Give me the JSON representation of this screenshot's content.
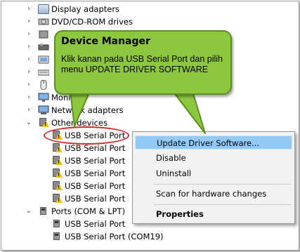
{
  "tree": {
    "top_items": [
      {
        "label": "Display adapters",
        "chevron": "›"
      },
      {
        "label": "DVD/CD-ROM drives",
        "chevron": "›"
      },
      {
        "label": "",
        "chevron": "›"
      },
      {
        "label": "",
        "chevron": "›"
      },
      {
        "label": "",
        "chevron": "›"
      },
      {
        "label": "",
        "chevron": "›"
      },
      {
        "label": "",
        "chevron": "›"
      },
      {
        "label": "Monitors",
        "chevron": "›"
      },
      {
        "label": "Network adapters",
        "chevron": "›"
      }
    ],
    "other_devices": {
      "label": "Other devices",
      "chevron": "⌄"
    },
    "usb_children": [
      "USB Serial Port",
      "USB Serial Port",
      "USB Serial Port",
      "USB Serial Port",
      "USB Serial Port",
      "USB Serial Port"
    ],
    "ports": {
      "label": "Ports (COM & LPT)",
      "chevron": "⌄"
    },
    "ports_children": [
      "USB Serial Port",
      "USB Serial Port (COM19)"
    ]
  },
  "callout": {
    "title": "Device Manager",
    "body": "Klik kanan pada USB Serial Port dan pilih menu UPDATE DRIVER SOFTWARE"
  },
  "context_menu": {
    "items": [
      {
        "label": "Update Driver Software...",
        "selected": true
      },
      {
        "label": "Disable"
      },
      {
        "label": "Uninstall"
      },
      {
        "label": "Scan for hardware changes"
      },
      {
        "label": "Properties",
        "bold": true
      }
    ]
  },
  "colors": {
    "callout_fill": "#8dc63f",
    "callout_border": "#5a8f1f",
    "highlight_oval": "#d42a2a",
    "menu_selection": "#91c9f7"
  }
}
